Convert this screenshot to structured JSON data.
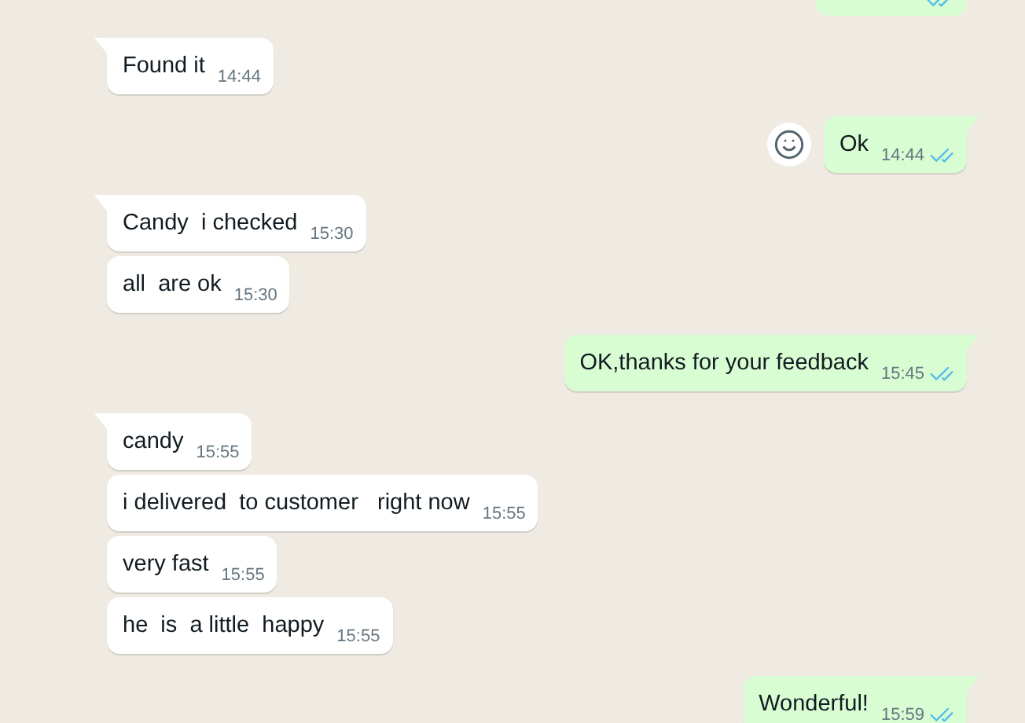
{
  "groups": [
    {
      "outgoing": true,
      "cut_off": true,
      "messages": [
        {
          "read": true
        }
      ]
    },
    {
      "outgoing": false,
      "messages": [
        {
          "text": "Found it",
          "time": "14:44",
          "tail": true
        }
      ]
    },
    {
      "outgoing": true,
      "messages": [
        {
          "text": "Ok",
          "time": "14:44",
          "read": true,
          "tail": true,
          "react_button": true
        }
      ]
    },
    {
      "outgoing": false,
      "messages": [
        {
          "text": "Candy  i checked",
          "time": "15:30",
          "tail": true
        },
        {
          "text": "all  are ok",
          "time": "15:30",
          "tail": false
        }
      ]
    },
    {
      "outgoing": true,
      "messages": [
        {
          "text": "OK,thanks for your feedback",
          "time": "15:45",
          "read": true,
          "tail": true
        }
      ]
    },
    {
      "outgoing": false,
      "messages": [
        {
          "text": "candy",
          "time": "15:55",
          "tail": true
        },
        {
          "text": "i delivered  to customer   right now",
          "time": "15:55",
          "tail": false
        },
        {
          "text": "very fast",
          "time": "15:55",
          "tail": false
        },
        {
          "text": "he  is  a little  happy",
          "time": "15:55",
          "tail": false
        }
      ]
    },
    {
      "outgoing": true,
      "messages": [
        {
          "text": "Wonderful!",
          "time": "15:59",
          "read": true,
          "tail": true
        }
      ]
    }
  ]
}
